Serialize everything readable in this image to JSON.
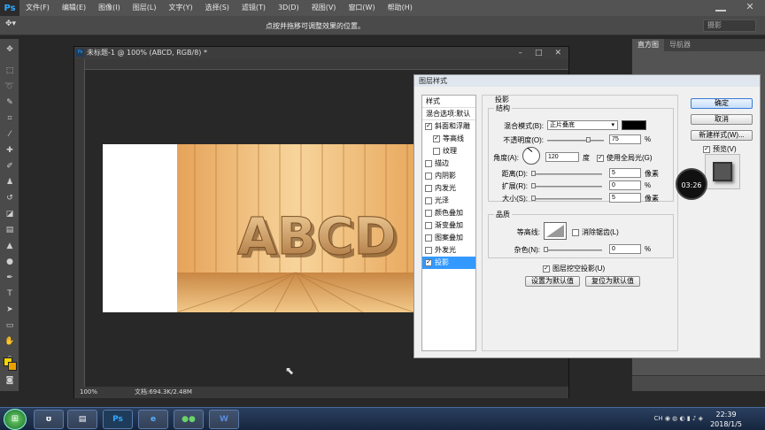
{
  "menubar": {
    "logo": "Ps",
    "items": [
      "文件(F)",
      "编辑(E)",
      "图像(I)",
      "图层(L)",
      "文字(Y)",
      "选择(S)",
      "滤镜(T)",
      "3D(D)",
      "视图(V)",
      "窗口(W)",
      "帮助(H)"
    ]
  },
  "options_bar": {
    "hint": "点按并拖移可调整效果的位置。",
    "workspace": "摄影"
  },
  "document": {
    "tab_title": "未标题-1 @ 100% (ABCD, RGB/8) *",
    "canvas_text": "ABCD",
    "zoom": "100%",
    "doc_size": "文档:694.3K/2.48M"
  },
  "right_panel": {
    "tabs": [
      "直方图",
      "导航器"
    ]
  },
  "dialog": {
    "title": "图层样式",
    "styles_header": "样式",
    "blend_options": "混合选项:默认",
    "styles": [
      {
        "label": "斜面和浮雕",
        "checked": true,
        "sub": false,
        "selected": false
      },
      {
        "label": "等高线",
        "checked": true,
        "sub": true,
        "selected": false
      },
      {
        "label": "纹理",
        "checked": false,
        "sub": true,
        "selected": false
      },
      {
        "label": "描边",
        "checked": false,
        "sub": false,
        "selected": false
      },
      {
        "label": "内阴影",
        "checked": false,
        "sub": false,
        "selected": false
      },
      {
        "label": "内发光",
        "checked": false,
        "sub": false,
        "selected": false
      },
      {
        "label": "光泽",
        "checked": false,
        "sub": false,
        "selected": false
      },
      {
        "label": "颜色叠加",
        "checked": false,
        "sub": false,
        "selected": false
      },
      {
        "label": "渐变叠加",
        "checked": false,
        "sub": false,
        "selected": false
      },
      {
        "label": "图案叠加",
        "checked": false,
        "sub": false,
        "selected": false
      },
      {
        "label": "外发光",
        "checked": false,
        "sub": false,
        "selected": false
      },
      {
        "label": "投影",
        "checked": true,
        "sub": false,
        "selected": true
      }
    ],
    "section_title": "投影",
    "structure": {
      "title": "结构",
      "blend_mode_label": "混合模式(B):",
      "blend_mode_value": "正片叠底",
      "blend_color": "#000000",
      "opacity_label": "不透明度(O):",
      "opacity_value": "75",
      "opacity_unit": "%",
      "opacity_fraction": 0.75,
      "angle_label": "角度(A):",
      "angle_value": "120",
      "angle_unit": "度",
      "global_light_label": "使用全局光(G)",
      "distance_label": "距离(D):",
      "distance_value": "5",
      "distance_unit": "像素",
      "spread_label": "扩展(R):",
      "spread_value": "0",
      "spread_unit": "%",
      "size_label": "大小(S):",
      "size_value": "5",
      "size_unit": "像素"
    },
    "quality": {
      "title": "品质",
      "contour_label": "等高线:",
      "antialias_label": "消除锯齿(L)",
      "noise_label": "杂色(N):",
      "noise_value": "0",
      "noise_unit": "%"
    },
    "knockout_label": "图层挖空投影(U)",
    "set_default": "设置为默认值",
    "reset_default": "复位为默认值",
    "ok": "确定",
    "cancel": "取消",
    "new_style": "新建样式(W)...",
    "preview_label": "预览(V)"
  },
  "overlay": {
    "timer": "03:26"
  },
  "taskbar": {
    "apps": [
      "Ps",
      "e",
      "W"
    ],
    "clock_time": "22:39",
    "clock_date": "2018/1/5",
    "tray_lang": "CH"
  }
}
